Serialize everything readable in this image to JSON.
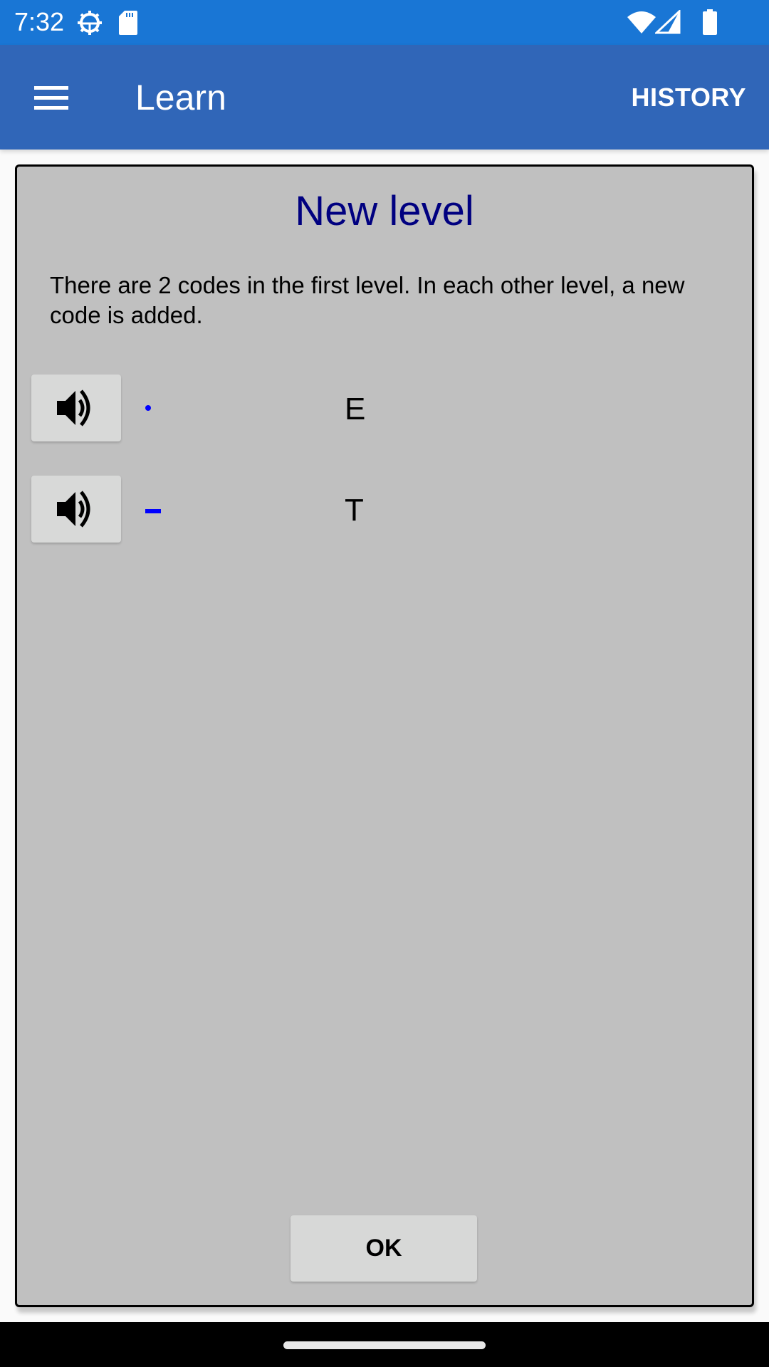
{
  "status_bar": {
    "time": "7:32",
    "left_icons": [
      "settings-gear-icon",
      "sd-card-icon"
    ],
    "right_icons": [
      "wifi-icon",
      "cell-signal-icon",
      "battery-icon"
    ]
  },
  "app_bar": {
    "menu_icon": "hamburger-menu-icon",
    "title": "Learn",
    "history_label": "HISTORY",
    "color": "#3066b8"
  },
  "dialog": {
    "title": "New level",
    "description": "There are 2 codes in the first level. In each other level, a new code is added.",
    "codes": [
      {
        "symbol_type": "dot",
        "morse": "·",
        "letter": "E",
        "play_icon": "speaker-icon"
      },
      {
        "symbol_type": "dash",
        "morse": "–",
        "letter": "T",
        "play_icon": "speaker-icon"
      }
    ],
    "ok_label": "OK",
    "title_color": "#000080",
    "symbol_color": "#0000ff"
  },
  "nav_bar": {
    "home_indicator": "home-pill"
  }
}
